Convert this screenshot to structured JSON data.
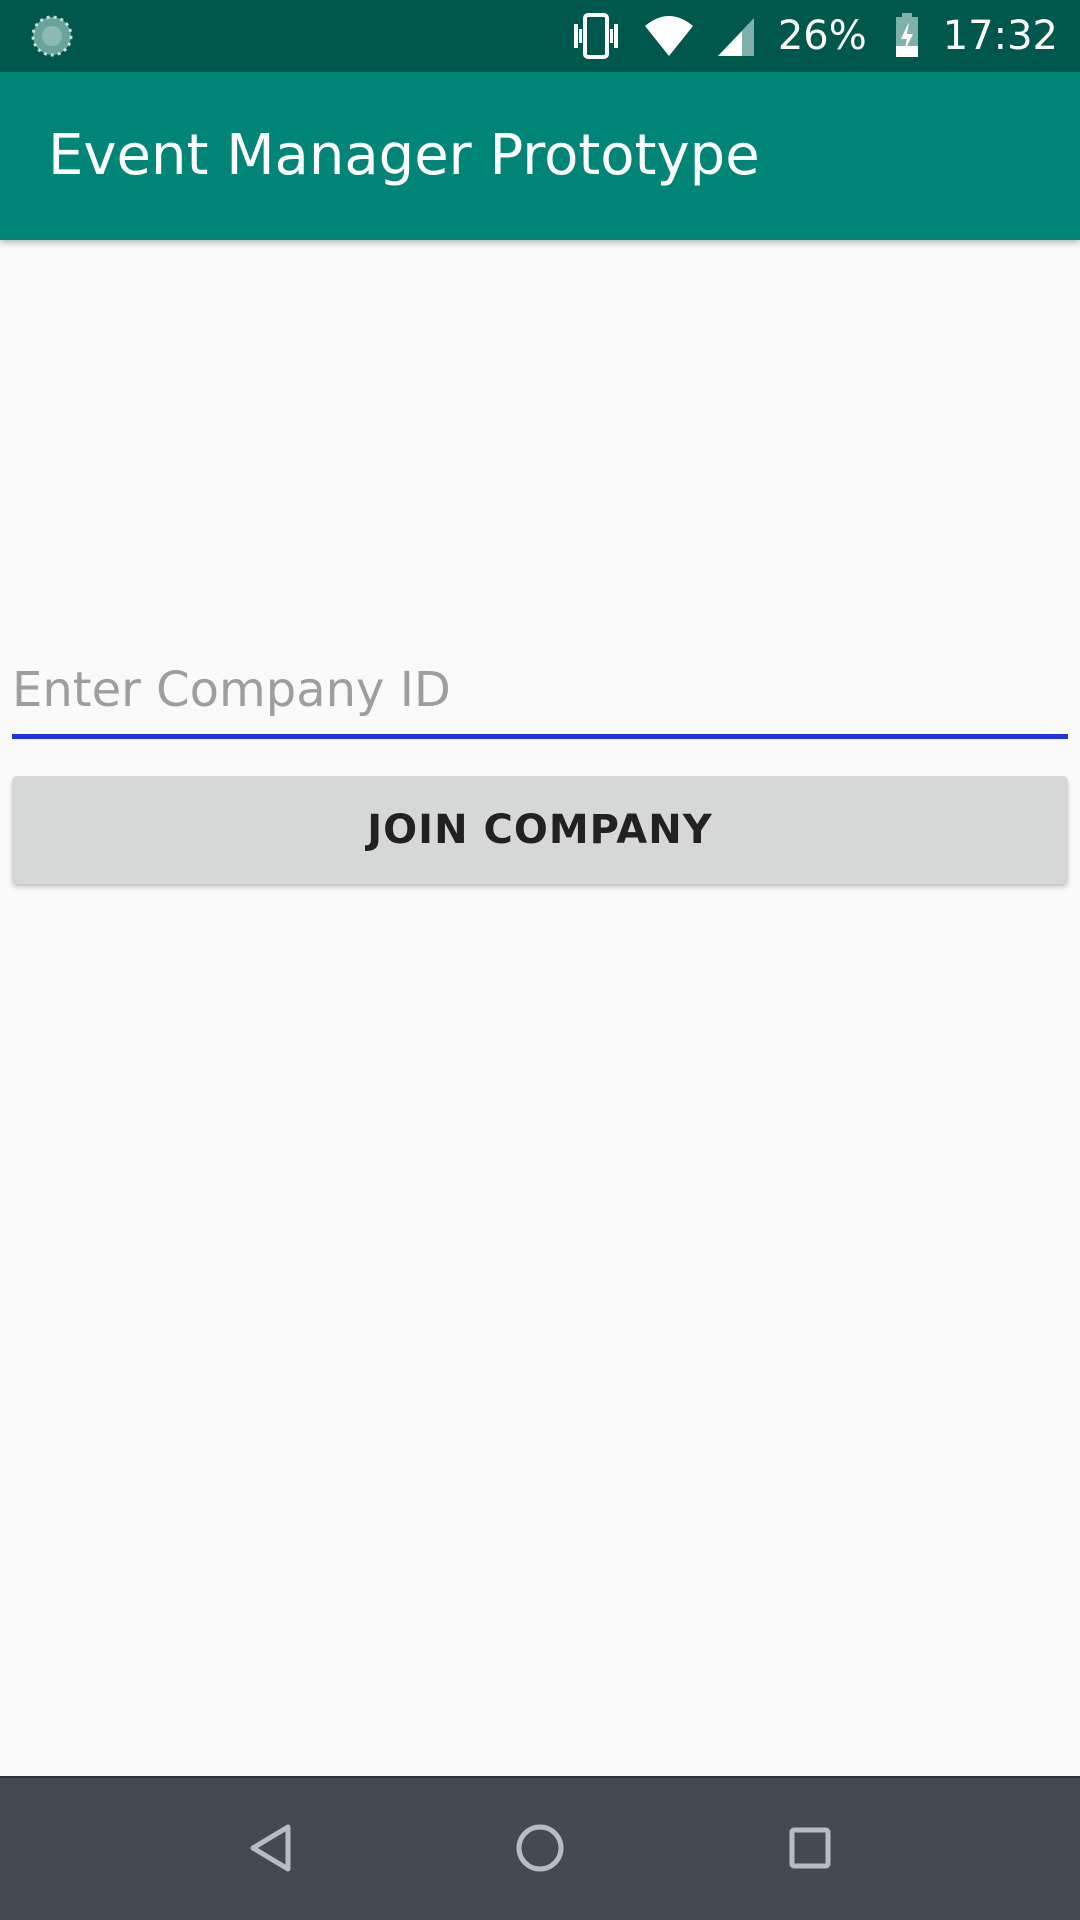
{
  "status_bar": {
    "left_icon": "loading-spinner-icon",
    "vibrate_icon": "vibrate-icon",
    "wifi_icon": "wifi-icon",
    "signal_icon": "cell-signal-icon",
    "battery_percent": "26%",
    "battery_icon": "battery-charging-icon",
    "time": "17:32"
  },
  "app_bar": {
    "title": "Event Manager Prototype"
  },
  "form": {
    "company_id_value": "",
    "company_id_placeholder": "Enter Company ID",
    "join_button_label": "JOIN COMPANY"
  },
  "nav_bar": {
    "back_icon": "back-triangle-icon",
    "home_icon": "home-circle-icon",
    "recents_icon": "recents-square-icon"
  },
  "colors": {
    "status_bar": "#00584c",
    "app_bar": "#008577",
    "background": "#fafafa",
    "field_underline": "#2233dd",
    "button_bg": "#d6d7d7",
    "nav_bar": "#434a50"
  }
}
